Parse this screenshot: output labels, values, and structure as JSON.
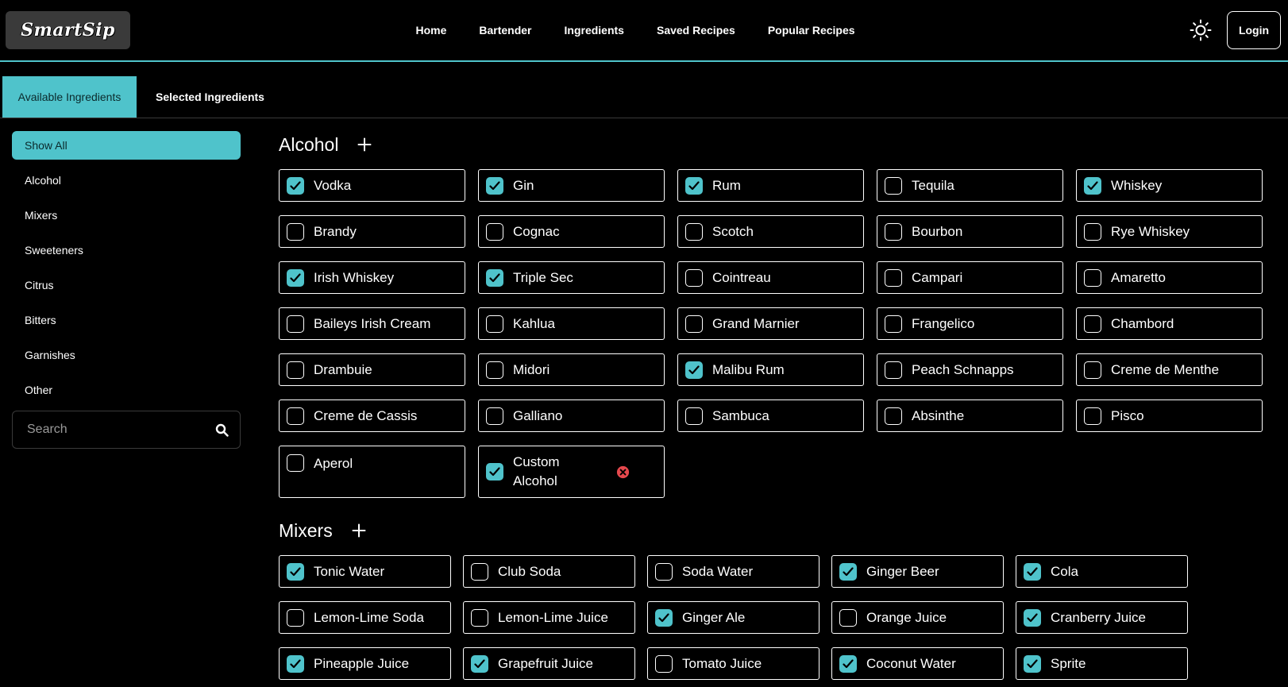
{
  "app": {
    "logo_text": "SmartSip"
  },
  "nav": {
    "links": [
      "Home",
      "Bartender",
      "Ingredients",
      "Saved Recipes",
      "Popular Recipes"
    ],
    "login_label": "Login"
  },
  "tabs": {
    "active": "Available Ingredients",
    "second": "Selected Ingredients"
  },
  "sidebar": {
    "items": [
      "Show All",
      "Alcohol",
      "Mixers",
      "Sweeteners",
      "Citrus",
      "Bitters",
      "Garnishes",
      "Other"
    ],
    "search_placeholder": "Search"
  },
  "alcohol": {
    "title": "Alcohol",
    "items": [
      {
        "label": "Vodka",
        "checked": true
      },
      {
        "label": "Gin",
        "checked": true
      },
      {
        "label": "Rum",
        "checked": true
      },
      {
        "label": "Tequila",
        "checked": false
      },
      {
        "label": "Whiskey",
        "checked": true
      },
      {
        "label": "Brandy",
        "checked": false
      },
      {
        "label": "Cognac",
        "checked": false
      },
      {
        "label": "Scotch",
        "checked": false
      },
      {
        "label": "Bourbon",
        "checked": false
      },
      {
        "label": "Rye Whiskey",
        "checked": false
      },
      {
        "label": "Irish Whiskey",
        "checked": true
      },
      {
        "label": "Triple Sec",
        "checked": true
      },
      {
        "label": "Cointreau",
        "checked": false
      },
      {
        "label": "Campari",
        "checked": false
      },
      {
        "label": "Amaretto",
        "checked": false
      },
      {
        "label": "Baileys Irish Cream",
        "checked": false
      },
      {
        "label": "Kahlua",
        "checked": false
      },
      {
        "label": "Grand Marnier",
        "checked": false
      },
      {
        "label": "Frangelico",
        "checked": false
      },
      {
        "label": "Chambord",
        "checked": false
      },
      {
        "label": "Drambuie",
        "checked": false
      },
      {
        "label": "Midori",
        "checked": false
      },
      {
        "label": "Malibu Rum",
        "checked": true
      },
      {
        "label": "Peach Schnapps",
        "checked": false
      },
      {
        "label": "Creme de Menthe",
        "checked": false
      },
      {
        "label": "Creme de Cassis",
        "checked": false
      },
      {
        "label": "Galliano",
        "checked": false
      },
      {
        "label": "Sambuca",
        "checked": false
      },
      {
        "label": "Absinthe",
        "checked": false
      },
      {
        "label": "Pisco",
        "checked": false
      },
      {
        "label": "Aperol",
        "checked": false
      },
      {
        "label": "Custom Alcohol",
        "checked": true,
        "custom": true
      }
    ]
  },
  "mixers": {
    "title": "Mixers",
    "items": [
      {
        "label": "Tonic Water",
        "checked": true
      },
      {
        "label": "Club Soda",
        "checked": false
      },
      {
        "label": "Soda Water",
        "checked": false
      },
      {
        "label": "Ginger Beer",
        "checked": true
      },
      {
        "label": "Cola",
        "checked": true
      },
      {
        "label": "Lemon-Lime Soda",
        "checked": false
      },
      {
        "label": "Lemon-Lime Juice",
        "checked": false
      },
      {
        "label": "Ginger Ale",
        "checked": true
      },
      {
        "label": "Orange Juice",
        "checked": false
      },
      {
        "label": "Cranberry Juice",
        "checked": true
      },
      {
        "label": "Pineapple Juice",
        "checked": true
      },
      {
        "label": "Grapefruit Juice",
        "checked": true
      },
      {
        "label": "Tomato Juice",
        "checked": false
      },
      {
        "label": "Coconut Water",
        "checked": true
      },
      {
        "label": "Sprite",
        "checked": true
      }
    ]
  },
  "colors": {
    "accent": "#4fc3cb",
    "remove": "#e5484d",
    "background": "#000000"
  }
}
